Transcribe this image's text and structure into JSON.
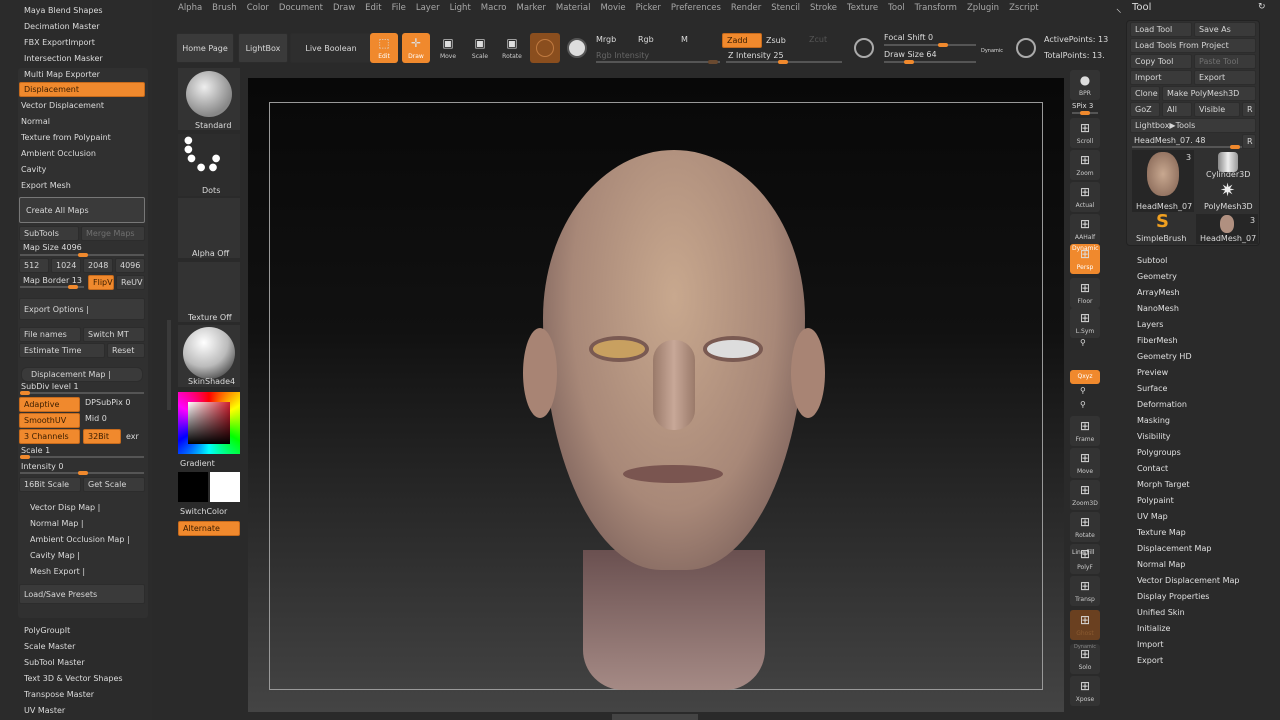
{
  "left_panel": {
    "plugins_top": [
      "Maya Blend Shapes",
      "Decimation Master",
      "FBX ExportImport",
      "Intersection Masker"
    ],
    "mme_header": "Multi Map Exporter",
    "map_items": [
      "Displacement",
      "Vector Displacement",
      "Normal",
      "Texture from Polypaint",
      "Ambient Occlusion",
      "Cavity",
      "Export Mesh"
    ],
    "create_all": "Create All Maps",
    "subtools": "SubTools",
    "merge_maps": "Merge Maps",
    "map_size": "Map Size 4096",
    "sizes": [
      "512",
      "1024",
      "2048",
      "4096"
    ],
    "map_border": "Map Border 13",
    "flipv": "FlipV",
    "reuv": "ReUV",
    "export_options": "Export Options |",
    "file_names": "File names",
    "switch_mt": "Switch MT",
    "estimate_time": "Estimate Time",
    "reset": "Reset",
    "disp_map": "Displacement Map |",
    "subdiv": "SubDiv level 1",
    "adaptive": "Adaptive",
    "dpsubpix": "DPSubPix 0",
    "smoothuv": "SmoothUV",
    "mid": "Mid 0",
    "channels": "3 Channels",
    "bit": "32Bit",
    "exr": "exr",
    "scale": "Scale 1",
    "intensity": "Intensity 0",
    "bit16": "16Bit Scale",
    "get_scale": "Get Scale",
    "sub_maps": [
      "Vector Disp Map |",
      "Normal Map |",
      "Ambient Occlusion Map |",
      "Cavity Map |",
      "Mesh Export |"
    ],
    "presets": "Load/Save Presets",
    "plugins_bottom": [
      "PolyGroupIt",
      "Scale Master",
      "SubTool Master",
      "Text 3D & Vector Shapes",
      "Transpose Master",
      "UV Master"
    ]
  },
  "menu": [
    "Alpha",
    "Brush",
    "Color",
    "Document",
    "Draw",
    "Edit",
    "File",
    "Layer",
    "Light",
    "Macro",
    "Marker",
    "Material",
    "Movie",
    "Picker",
    "Preferences",
    "Render",
    "Stencil",
    "Stroke",
    "Texture",
    "Tool",
    "Transform",
    "Zplugin",
    "Zscript"
  ],
  "toolbar": {
    "home": "Home Page",
    "lightbox": "LightBox",
    "live_boolean": "Live Boolean",
    "edit": "Edit",
    "draw": "Draw",
    "move": "Move",
    "scale": "Scale",
    "rotate": "Rotate",
    "mrgb": "Mrgb",
    "rgb": "Rgb",
    "m": "M",
    "rgb_intensity": "Rgb Intensity",
    "zadd": "Zadd",
    "zsub": "Zsub",
    "zcut": "Zcut",
    "z_intensity": "Z Intensity 25",
    "focal_shift": "Focal Shift 0",
    "draw_size": "Draw Size 64",
    "dynamic": "Dynamic",
    "active_points": "ActivePoints: 13",
    "total_points": "TotalPoints: 13."
  },
  "tool_column": {
    "brush": "Standard",
    "stroke": "Dots",
    "alpha": "Alpha Off",
    "texture": "Texture Off",
    "material": "SkinShade4",
    "gradient": "Gradient",
    "switch_color": "SwitchColor",
    "alternate": "Alternate"
  },
  "shelf": [
    "BPR",
    "SPix 3",
    "Scroll",
    "Zoom",
    "Actual",
    "AAHalf",
    "Persp",
    "Floor",
    "L.Sym",
    "",
    "Qxyz",
    "",
    "",
    "Frame",
    "Move",
    "Zoom3D",
    "Rotate",
    "PolyF",
    "Transp",
    "Ghost",
    "Solo",
    "Xpose"
  ],
  "shelf_extra": {
    "dynamic": "Dynamic",
    "line_fill": "Line Fill"
  },
  "tool_panel": {
    "title": "Tool",
    "load_tool": "Load Tool",
    "save_as": "Save As",
    "load_project": "Load Tools From Project",
    "copy_tool": "Copy Tool",
    "paste_tool": "Paste Tool",
    "import": "Import",
    "export": "Export",
    "clone": "Clone",
    "make_poly": "Make PolyMesh3D",
    "goz": "GoZ",
    "all": "All",
    "visible": "Visible",
    "r": "R",
    "lightbox_tools": "Lightbox▶Tools",
    "current": "HeadMesh_07. 48",
    "thumbs": [
      "HeadMesh_07",
      "Cylinder3D",
      "PolyMesh3D",
      "SimpleBrush",
      "HeadMesh_07"
    ],
    "count": "3",
    "sections": [
      "Subtool",
      "Geometry",
      "ArrayMesh",
      "NanoMesh",
      "Layers",
      "FiberMesh",
      "Geometry HD",
      "Preview",
      "Surface",
      "Deformation",
      "Masking",
      "Visibility",
      "Polygroups",
      "Contact",
      "Morph Target",
      "Polypaint",
      "UV Map",
      "Texture Map",
      "Displacement Map",
      "Normal Map",
      "Vector Displacement Map",
      "Display Properties",
      "Unified Skin",
      "Initialize",
      "Import",
      "Export"
    ]
  },
  "colors": {
    "accent": "#f0892d",
    "bg": "#2a2a2a"
  }
}
